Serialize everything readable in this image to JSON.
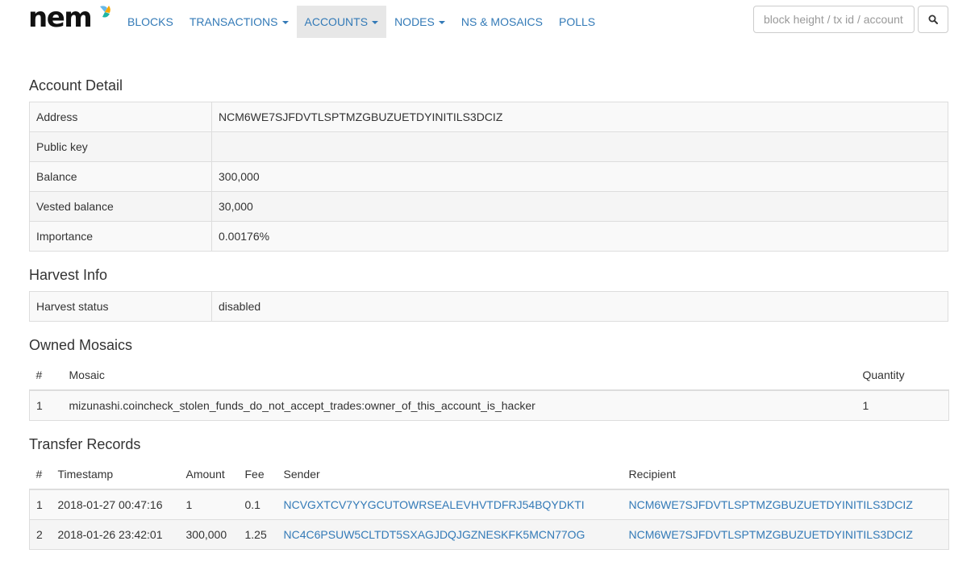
{
  "nav": {
    "logo_text": "nem",
    "items": [
      {
        "label": "BLOCKS"
      },
      {
        "label": "TRANSACTIONS"
      },
      {
        "label": "ACCOUNTS"
      },
      {
        "label": "NODES"
      },
      {
        "label": "NS & MOSAICS"
      },
      {
        "label": "POLLS"
      }
    ],
    "search_placeholder": "block height / tx id / account"
  },
  "account_detail": {
    "title": "Account Detail",
    "rows": [
      {
        "key": "Address",
        "value": "NCM6WE7SJFDVTLSPTMZGBUZUETDYINITILS3DCIZ"
      },
      {
        "key": "Public key",
        "value": ""
      },
      {
        "key": "Balance",
        "value": "300,000"
      },
      {
        "key": "Vested balance",
        "value": "30,000"
      },
      {
        "key": "Importance",
        "value": "0.00176%"
      }
    ]
  },
  "harvest_info": {
    "title": "Harvest Info",
    "rows": [
      {
        "key": "Harvest status",
        "value": "disabled"
      }
    ]
  },
  "owned_mosaics": {
    "title": "Owned Mosaics",
    "headers": {
      "num": "#",
      "mosaic": "Mosaic",
      "quantity": "Quantity"
    },
    "rows": [
      {
        "num": "1",
        "mosaic": "mizunashi.coincheck_stolen_funds_do_not_accept_trades:owner_of_this_account_is_hacker",
        "quantity": "1"
      }
    ]
  },
  "transfer_records": {
    "title": "Transfer Records",
    "headers": {
      "num": "#",
      "timestamp": "Timestamp",
      "amount": "Amount",
      "fee": "Fee",
      "sender": "Sender",
      "recipient": "Recipient"
    },
    "rows": [
      {
        "num": "1",
        "timestamp": "2018-01-27 00:47:16",
        "amount": "1",
        "fee": "0.1",
        "sender": "NCVGXTCV7YYGCUTOWRSEALEVHVTDFRJ54BQYDKTI",
        "recipient": "NCM6WE7SJFDVTLSPTMZGBUZUETDYINITILS3DCIZ"
      },
      {
        "num": "2",
        "timestamp": "2018-01-26 23:42:01",
        "amount": "300,000",
        "fee": "1.25",
        "sender": "NC4C6PSUW5CLTDT5SXAGJDQJGZNESKFK5MCN77OG",
        "recipient": "NCM6WE7SJFDVTLSPTMZGBUZUETDYINITILS3DCIZ"
      }
    ]
  },
  "colors": {
    "link": "#337ab7",
    "active_nav_bg": "#e7e7e7",
    "border": "#dddddd"
  },
  "icons": {
    "search": "search-icon",
    "logo": "nem-logo"
  }
}
